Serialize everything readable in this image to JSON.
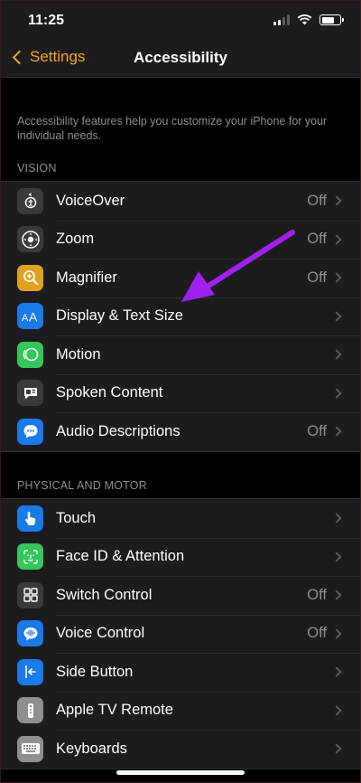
{
  "status": {
    "time": "11:25"
  },
  "nav": {
    "back_label": "Settings",
    "title": "Accessibility"
  },
  "intro": "Accessibility features help you customize your iPhone for your individual needs.",
  "sections": [
    {
      "header": "VISION",
      "items": [
        {
          "label": "VoiceOver",
          "value": "Off",
          "icon": "voiceover-icon",
          "color": "#3a3a3c"
        },
        {
          "label": "Zoom",
          "value": "Off",
          "icon": "zoom-icon",
          "color": "#3a3a3c"
        },
        {
          "label": "Magnifier",
          "value": "Off",
          "icon": "magnifier-icon",
          "color": "#e0a21b"
        },
        {
          "label": "Display & Text Size",
          "value": "",
          "icon": "display-text-size-icon",
          "color": "#1a7ae8"
        },
        {
          "label": "Motion",
          "value": "",
          "icon": "motion-icon",
          "color": "#34c759"
        },
        {
          "label": "Spoken Content",
          "value": "",
          "icon": "spoken-content-icon",
          "color": "#3a3a3c"
        },
        {
          "label": "Audio Descriptions",
          "value": "Off",
          "icon": "audio-descriptions-icon",
          "color": "#1a7ae8"
        }
      ]
    },
    {
      "header": "PHYSICAL AND MOTOR",
      "items": [
        {
          "label": "Touch",
          "value": "",
          "icon": "touch-icon",
          "color": "#1a7ae8"
        },
        {
          "label": "Face ID & Attention",
          "value": "",
          "icon": "face-id-icon",
          "color": "#34c759"
        },
        {
          "label": "Switch Control",
          "value": "Off",
          "icon": "switch-control-icon",
          "color": "#3a3a3c"
        },
        {
          "label": "Voice Control",
          "value": "Off",
          "icon": "voice-control-icon",
          "color": "#1a7ae8"
        },
        {
          "label": "Side Button",
          "value": "",
          "icon": "side-button-icon",
          "color": "#1a7ae8"
        },
        {
          "label": "Apple TV Remote",
          "value": "",
          "icon": "apple-tv-remote-icon",
          "color": "#8e8e93"
        },
        {
          "label": "Keyboards",
          "value": "",
          "icon": "keyboard-icon",
          "color": "#8e8e93"
        }
      ]
    }
  ],
  "accent_color": "#f5a623",
  "annotation_color": "#a020f0"
}
